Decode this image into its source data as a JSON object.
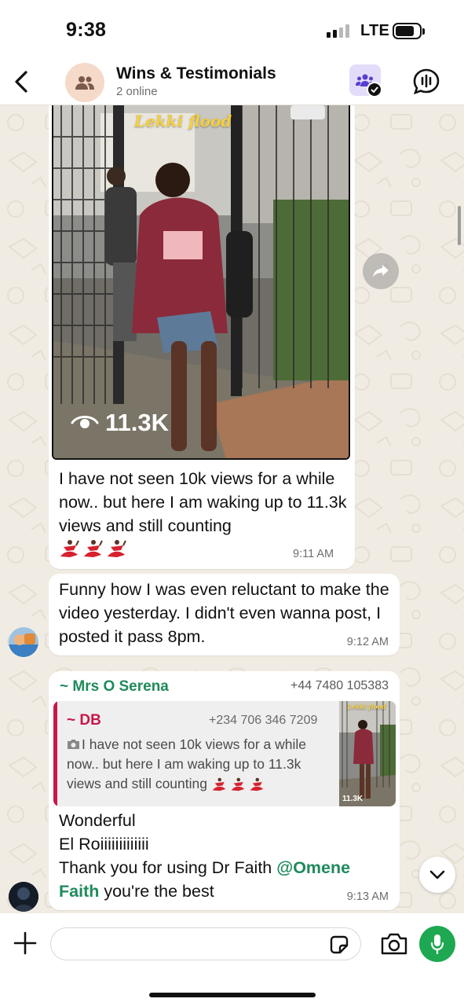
{
  "status_bar": {
    "time": "9:38",
    "network": "LTE",
    "signal_bars": 2
  },
  "header": {
    "title": "Wins & Testimonials",
    "subtitle": "2 online",
    "avatar_icon": "group-avatar-icon",
    "community_icon": "community-icon"
  },
  "messages": [
    {
      "type": "video",
      "video_overlay_title": "Lekki flood",
      "view_count": "11.3K",
      "text": "I have not seen 10k views for a while now.. but here I am waking up to 11.3k views and still counting",
      "emojis": "💃💃💃",
      "time": "9:11 AM"
    },
    {
      "type": "text",
      "text": "Funny how I was even reluctant to make the video yesterday. I didn't even wanna post, I posted it pass 8pm.",
      "time": "9:12 AM"
    },
    {
      "type": "reply",
      "sender": "~ Mrs O Serena",
      "sender_phone": "+44 7480 105383",
      "quoted": {
        "sender": "~ DB",
        "phone": "+234 706 346 7209",
        "text": "I have not seen 10k views for a while now.. but here I am waking up to 11.3k views and still counting",
        "thumb_count": "11.3K",
        "thumb_title": "Lekki flood"
      },
      "line1": "Wonderful",
      "line2": "El Roiiiiiiiiiiiii",
      "line3_prefix": "Thank you for using Dr Faith ",
      "mention_part1": "@Omene",
      "mention_part2": "Faith",
      "line4_suffix": " you're the best",
      "time": "9:13 AM"
    }
  ],
  "composer": {
    "placeholder": ""
  },
  "colors": {
    "accent_green": "#1da851",
    "sender_green": "#1f8a5b",
    "quote_red": "#c8174a",
    "wallpaper": "#f1ece3"
  }
}
